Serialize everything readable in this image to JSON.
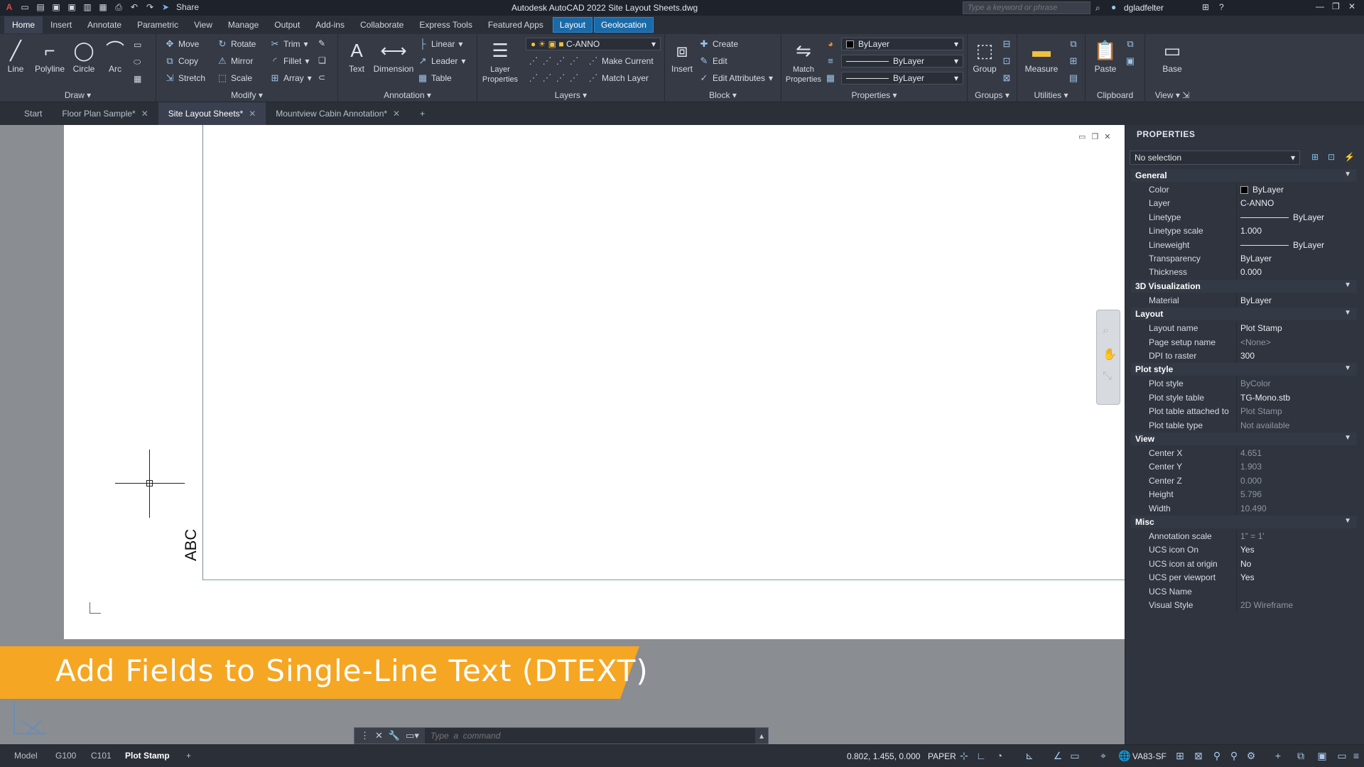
{
  "titlebar": {
    "app_title": "Autodesk AutoCAD 2022   Site Layout Sheets.dwg",
    "share_label": "Share",
    "search_placeholder": "Type a keyword or phrase",
    "user": "dgladfelter"
  },
  "ribbon_tabs": [
    "Home",
    "Insert",
    "Annotate",
    "Parametric",
    "View",
    "Manage",
    "Output",
    "Add-ins",
    "Collaborate",
    "Express Tools",
    "Featured Apps",
    "Layout",
    "Geolocation"
  ],
  "ribbon": {
    "draw": {
      "title": "Draw",
      "line": "Line",
      "polyline": "Polyline",
      "circle": "Circle",
      "arc": "Arc"
    },
    "modify": {
      "title": "Modify",
      "move": "Move",
      "rotate": "Rotate",
      "trim": "Trim",
      "copy": "Copy",
      "mirror": "Mirror",
      "fillet": "Fillet",
      "stretch": "Stretch",
      "scale": "Scale",
      "array": "Array"
    },
    "annotation": {
      "title": "Annotation",
      "text": "Text",
      "dimension": "Dimension",
      "linear": "Linear",
      "leader": "Leader",
      "table": "Table"
    },
    "layers": {
      "title": "Layers",
      "layer_properties": "Layer Properties",
      "current_layer": "C-ANNO",
      "make_current": "Make Current",
      "match_layer": "Match Layer"
    },
    "block": {
      "title": "Block",
      "insert": "Insert",
      "create": "Create",
      "edit": "Edit",
      "edit_attributes": "Edit Attributes"
    },
    "properties": {
      "title": "Properties",
      "match": "Match Properties",
      "color": "ByLayer",
      "linetype": "ByLayer",
      "lineweight": "ByLayer"
    },
    "groups": {
      "title": "Groups",
      "group": "Group"
    },
    "utilities": {
      "title": "Utilities",
      "measure": "Measure"
    },
    "clipboard": {
      "title": "Clipboard",
      "paste": "Paste"
    },
    "view": {
      "title": "View",
      "base": "Base"
    }
  },
  "doc_tabs": [
    {
      "label": "Start",
      "closable": false
    },
    {
      "label": "Floor Plan Sample*",
      "closable": true
    },
    {
      "label": "Site Layout Sheets*",
      "closable": true,
      "active": true
    },
    {
      "label": "Mountview Cabin Annotation*",
      "closable": true
    }
  ],
  "canvas": {
    "text": "ABC"
  },
  "banner": {
    "text": "Add Fields to Single-Line Text (DTEXT)"
  },
  "command": {
    "placeholder": "Type  a  command"
  },
  "layout_tabs": [
    "Model",
    "G100",
    "C101",
    "Plot Stamp"
  ],
  "status": {
    "coords": "0.802, 1.455, 0.000",
    "space": "PAPER",
    "scale": "VA83-SF"
  },
  "properties": {
    "title": "PROPERTIES",
    "selection": "No selection",
    "categories": [
      {
        "name": "General",
        "rows": [
          {
            "k": "Color",
            "v": "ByLayer",
            "swatch": true
          },
          {
            "k": "Layer",
            "v": "C-ANNO"
          },
          {
            "k": "Linetype",
            "v": "ByLayer",
            "line": true
          },
          {
            "k": "Linetype scale",
            "v": "1.000"
          },
          {
            "k": "Lineweight",
            "v": "ByLayer",
            "line": true
          },
          {
            "k": "Transparency",
            "v": "ByLayer"
          },
          {
            "k": "Thickness",
            "v": "0.000"
          }
        ]
      },
      {
        "name": "3D Visualization",
        "rows": [
          {
            "k": "Material",
            "v": "ByLayer"
          }
        ]
      },
      {
        "name": "Layout",
        "rows": [
          {
            "k": "Layout name",
            "v": "Plot Stamp"
          },
          {
            "k": "Page setup name",
            "v": "<None>",
            "dim": true
          },
          {
            "k": "DPI to raster",
            "v": "300"
          }
        ]
      },
      {
        "name": "Plot style",
        "rows": [
          {
            "k": "Plot style",
            "v": "ByColor",
            "dim": true
          },
          {
            "k": "Plot style table",
            "v": "TG-Mono.stb"
          },
          {
            "k": "Plot table attached to",
            "v": "Plot Stamp",
            "dim": true
          },
          {
            "k": "Plot table type",
            "v": "Not available",
            "dim": true
          }
        ]
      },
      {
        "name": "View",
        "rows": [
          {
            "k": "Center X",
            "v": "4.651",
            "dim": true
          },
          {
            "k": "Center Y",
            "v": "1.903",
            "dim": true
          },
          {
            "k": "Center Z",
            "v": "0.000",
            "dim": true
          },
          {
            "k": "Height",
            "v": "5.796",
            "dim": true
          },
          {
            "k": "Width",
            "v": "10.490",
            "dim": true
          }
        ]
      },
      {
        "name": "Misc",
        "rows": [
          {
            "k": "Annotation scale",
            "v": "1\" = 1'",
            "dim": true
          },
          {
            "k": "UCS icon On",
            "v": "Yes"
          },
          {
            "k": "UCS icon at origin",
            "v": "No"
          },
          {
            "k": "UCS per viewport",
            "v": "Yes"
          },
          {
            "k": "UCS Name",
            "v": ""
          },
          {
            "k": "Visual Style",
            "v": "2D Wireframe",
            "dim": true
          }
        ]
      }
    ]
  }
}
